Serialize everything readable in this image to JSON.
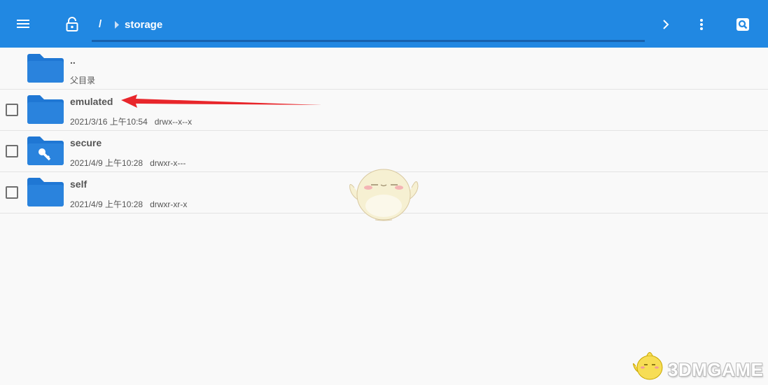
{
  "toolbar": {
    "path_root": "/",
    "path_current": "storage",
    "background_color": "#2188e2"
  },
  "list": {
    "items": [
      {
        "name": "..",
        "meta": "父目录",
        "icon": "folder-icon",
        "has_checkbox": false
      },
      {
        "name": "emulated",
        "meta": "2021/3/16 上午10:54   drwx--x--x",
        "icon": "folder-icon",
        "has_checkbox": true
      },
      {
        "name": "secure",
        "meta": "2021/4/9 上午10:28   drwxr-x---",
        "icon": "folder-key-icon",
        "has_checkbox": true
      },
      {
        "name": "self",
        "meta": "2021/4/9 上午10:28   drwxr-xr-x",
        "icon": "folder-icon",
        "has_checkbox": true
      }
    ]
  },
  "watermark": {
    "text": "3DMGAME"
  },
  "colors": {
    "folder": "#1f77d4",
    "arrow": "#e8262b"
  }
}
